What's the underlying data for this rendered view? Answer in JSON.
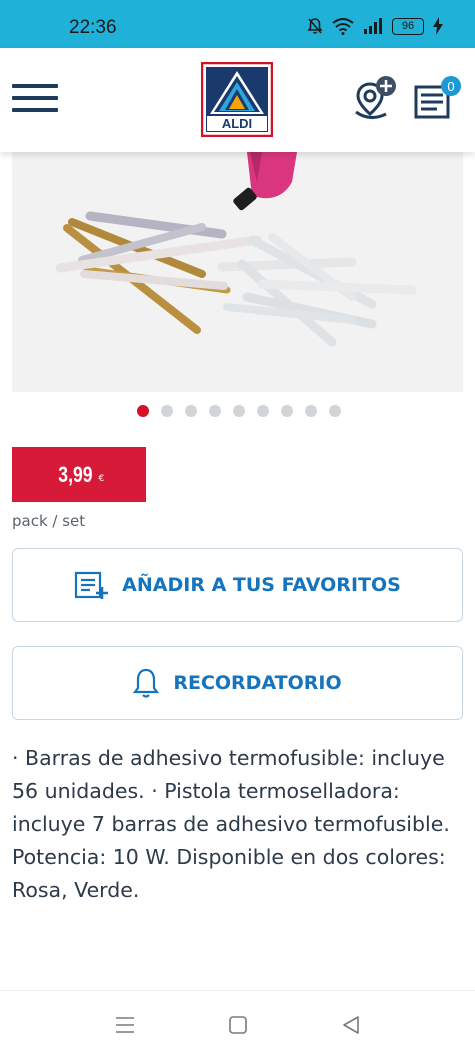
{
  "status_bar": {
    "time": "22:36",
    "battery": "96"
  },
  "header": {
    "logo_text": "ALDI",
    "cart_count": "0"
  },
  "carousel": {
    "total": 9,
    "active": 1
  },
  "price": {
    "value": "3,99",
    "currency": "€",
    "unit": "pack / set"
  },
  "actions": {
    "favorites_label": "AÑADIR A TUS FAVORITOS",
    "reminder_label": "RECORDATORIO"
  },
  "description": "· Barras de adhesivo termofusible: incluye 56 unidades. · Pistola termoselladora: incluye 7 barras de adhesivo termofusible. Potencia: 10 W. Disponible en dos colores: Rosa, Verde.",
  "colors": {
    "status_bar": "#1fb1d8",
    "price_bg": "#d81a39",
    "accent_blue": "#1574bd",
    "brand_navy": "#1f3b5c"
  },
  "icons": [
    "bell-off-icon",
    "wifi-icon",
    "signal-icon",
    "battery-icon",
    "charging-icon",
    "menu-icon",
    "store-location-icon",
    "shopping-list-icon",
    "list-add-icon",
    "bell-icon",
    "recent-apps-icon",
    "home-icon",
    "back-icon"
  ]
}
